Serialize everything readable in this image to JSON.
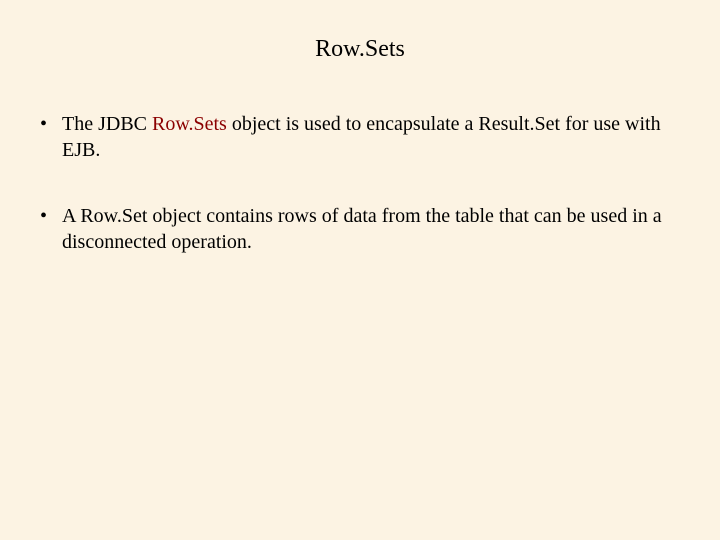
{
  "title": "Row.Sets",
  "bullets": [
    {
      "pre": "The JDBC ",
      "highlight": "Row.Sets",
      "post": " object is used to encapsulate a Result.Set for use with EJB."
    },
    {
      "pre": "A Row.Set  object contains rows of data from the table that can be used in a disconnected operation.",
      "highlight": "",
      "post": ""
    }
  ]
}
